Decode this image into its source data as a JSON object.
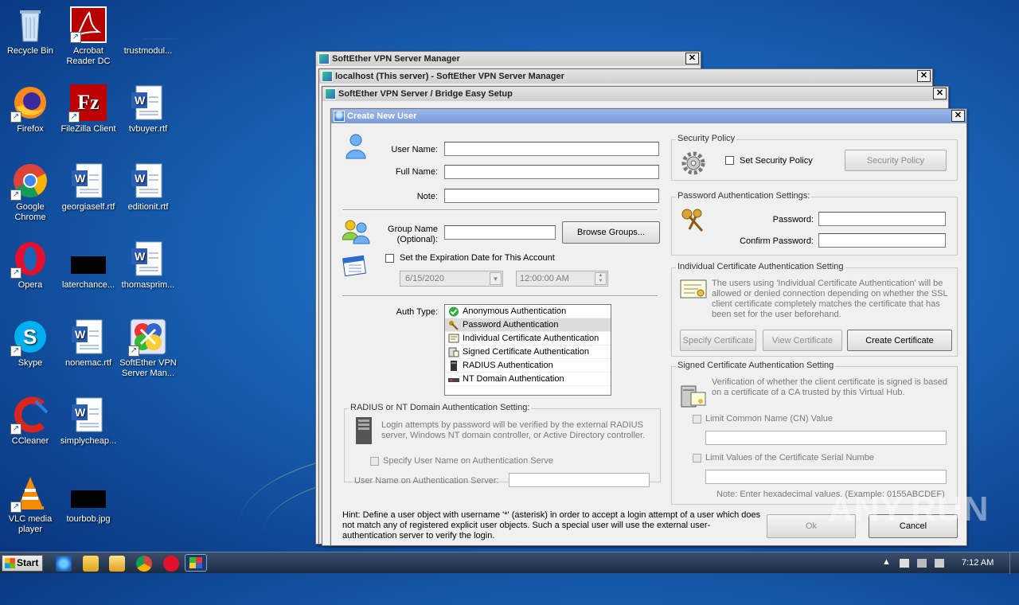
{
  "desktop": {
    "icons": [
      {
        "label": "Recycle Bin",
        "icon": "recycle-bin-icon"
      },
      {
        "label": "Acrobat Reader DC",
        "icon": "acrobat-icon"
      },
      {
        "label": "trustmodul...",
        "icon": "blank-file-icon"
      },
      {
        "label": "Firefox",
        "icon": "firefox-icon"
      },
      {
        "label": "FileZilla Client",
        "icon": "filezilla-icon"
      },
      {
        "label": "tvbuyer.rtf",
        "icon": "word-doc-icon"
      },
      {
        "label": "Google Chrome",
        "icon": "chrome-icon"
      },
      {
        "label": "georgiaself.rtf",
        "icon": "word-doc-icon"
      },
      {
        "label": "editionit.rtf",
        "icon": "word-doc-icon"
      },
      {
        "label": "Opera",
        "icon": "opera-icon"
      },
      {
        "label": "laterchance...",
        "icon": "black-thumbnail-icon"
      },
      {
        "label": "thomasprim...",
        "icon": "word-doc-icon"
      },
      {
        "label": "Skype",
        "icon": "skype-icon"
      },
      {
        "label": "nonemac.rtf",
        "icon": "word-doc-icon"
      },
      {
        "label": "SoftEther VPN Server Man...",
        "icon": "softether-icon"
      },
      {
        "label": "CCleaner",
        "icon": "ccleaner-icon"
      },
      {
        "label": "simplycheap...",
        "icon": "word-doc-icon"
      },
      {
        "label": "VLC media player",
        "icon": "vlc-icon"
      },
      {
        "label": "tourbob.jpg",
        "icon": "black-thumbnail-icon"
      }
    ]
  },
  "windows": {
    "w1_title": "SoftEther VPN Server Manager",
    "w2_title": "localhost (This server) - SoftEther VPN Server Manager",
    "w3_title": "SoftEther VPN Server / Bridge Easy Setup",
    "close_glyph": "✕"
  },
  "dialog": {
    "title": "Create New User",
    "user_name_label": "User Name:",
    "user_name_value": "",
    "full_name_label": "Full Name:",
    "full_name_value": "",
    "note_label": "Note:",
    "note_value": "",
    "group_name_label": "Group Name\n(Optional):",
    "group_name_value": "",
    "browse_groups": "Browse Groups...",
    "expiration_label": "Set the Expiration Date for This Account",
    "expiration_date": "6/15/2020",
    "expiration_time": "12:00:00 AM",
    "auth_type_label": "Auth Type:",
    "auth_types": [
      {
        "label": "Anonymous Authentication",
        "icon": "check-icon"
      },
      {
        "label": "Password Authentication",
        "icon": "keys-icon"
      },
      {
        "label": "Individual Certificate Authentication",
        "icon": "certificate-icon"
      },
      {
        "label": "Signed Certificate Authentication",
        "icon": "signed-cert-icon"
      },
      {
        "label": "RADIUS Authentication",
        "icon": "server-icon"
      },
      {
        "label": "NT Domain Authentication",
        "icon": "domain-icon"
      }
    ],
    "selected_auth": 1,
    "radius_group_title": "RADIUS or NT Domain Authentication Setting:",
    "radius_desc": "Login attempts by password will be verified by the external RADIUS server, Windows NT domain controller, or Active Directory controller.",
    "specify_user_label": "Specify User Name on Authentication Serve",
    "user_on_server_label": "User Name on Authentication Server:",
    "hint": "Hint: Define a user object with username '*' (asterisk) in order to accept a login attempt of a user which does not match any of registered explicit user objects. Such a special user will use the external user-authentication server to verify the login.",
    "security_policy_group": "Security Policy",
    "set_security_policy_label": "Set Security Policy",
    "security_policy_button": "Security Policy",
    "password_group": "Password Authentication Settings:",
    "password_label": "Password:",
    "confirm_password_label": "Confirm Password:",
    "indiv_cert_group": "Individual Certificate Authentication Setting",
    "indiv_cert_desc": "The users using 'Individual Certificate Authentication' will be allowed or denied connection depending on whether the SSL client certificate completely matches the certificate that has been set for the user beforehand.",
    "specify_certificate": "Specify Certificate",
    "view_certificate": "View Certificate",
    "create_certificate": "Create Certificate",
    "signed_cert_group": "Signed Certificate Authentication Setting",
    "signed_cert_desc": "Verification of whether the client certificate is signed is based on a certificate of a CA trusted by this Virtual Hub.",
    "limit_cn_label": "Limit Common Name (CN) Value",
    "limit_serial_label": "Limit Values of the Certificate Serial Numbe",
    "serial_note": "Note: Enter hexadecimal values. (Example: 0155ABCDEF)",
    "ok": "Ok",
    "cancel": "Cancel"
  },
  "taskbar": {
    "start": "Start",
    "clock": "7:12 AM"
  },
  "watermark": "ANY.RUN"
}
